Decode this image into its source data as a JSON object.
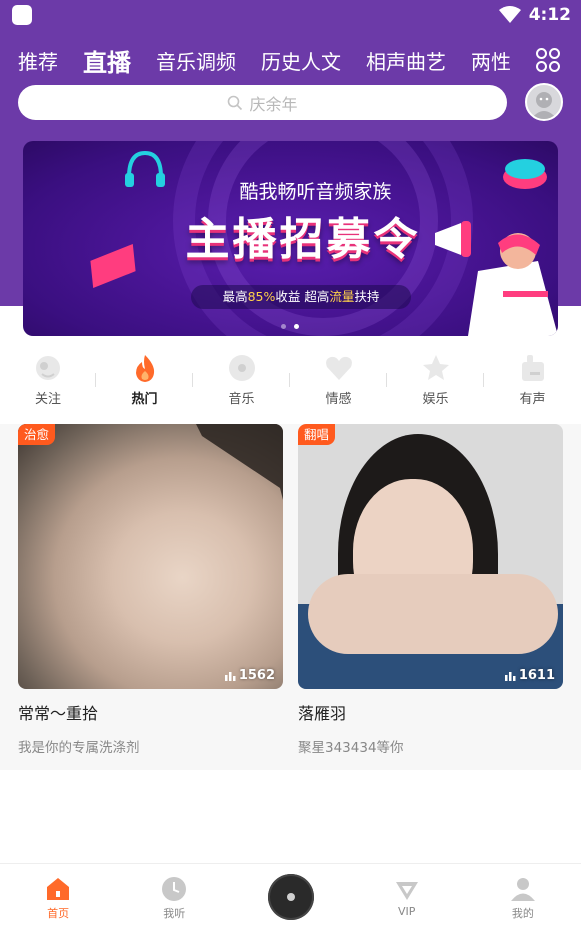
{
  "status_bar": {
    "time": "4:12"
  },
  "tabs": [
    {
      "label": "推荐",
      "active": false
    },
    {
      "label": "直播",
      "active": true
    },
    {
      "label": "音乐调频",
      "active": false
    },
    {
      "label": "历史人文",
      "active": false
    },
    {
      "label": "相声曲艺",
      "active": false
    },
    {
      "label": "两性",
      "active": false
    }
  ],
  "search": {
    "placeholder": "庆余年"
  },
  "banner": {
    "subtitle": "酷我畅听音频家族",
    "title": "主播招募令",
    "pill_prefix": "最高",
    "pill_highlight1": "85%",
    "pill_middle": "收益  超高",
    "pill_highlight2": "流量",
    "pill_suffix": "扶持",
    "dots": 2,
    "active_dot": 1
  },
  "categories": [
    {
      "label": "关注",
      "icon": "follow-icon"
    },
    {
      "label": "热门",
      "icon": "fire-icon",
      "active": true
    },
    {
      "label": "音乐",
      "icon": "music-disc-icon"
    },
    {
      "label": "情感",
      "icon": "heart-icon"
    },
    {
      "label": "娱乐",
      "icon": "star-icon"
    },
    {
      "label": "有声",
      "icon": "radio-icon"
    }
  ],
  "cards": [
    {
      "tag": "治愈",
      "count": "1562",
      "title": "常常～重拾",
      "subtitle": "我是你的专属洗涤剂"
    },
    {
      "tag": "翻唱",
      "count": "1611",
      "title": "落雁羽",
      "subtitle": "聚星343434等你"
    }
  ],
  "bottom_nav": [
    {
      "label": "首页",
      "icon": "home-icon",
      "active": true
    },
    {
      "label": "我听",
      "icon": "clock-icon"
    },
    {
      "label": "",
      "icon": "disc-player-icon"
    },
    {
      "label": "VIP",
      "icon": "vip-diamond-icon"
    },
    {
      "label": "我的",
      "icon": "user-icon"
    }
  ],
  "colors": {
    "header_purple": "#6c3aa8",
    "accent_orange": "#ff6a2a",
    "tag_orange": "#ff5a1e"
  }
}
